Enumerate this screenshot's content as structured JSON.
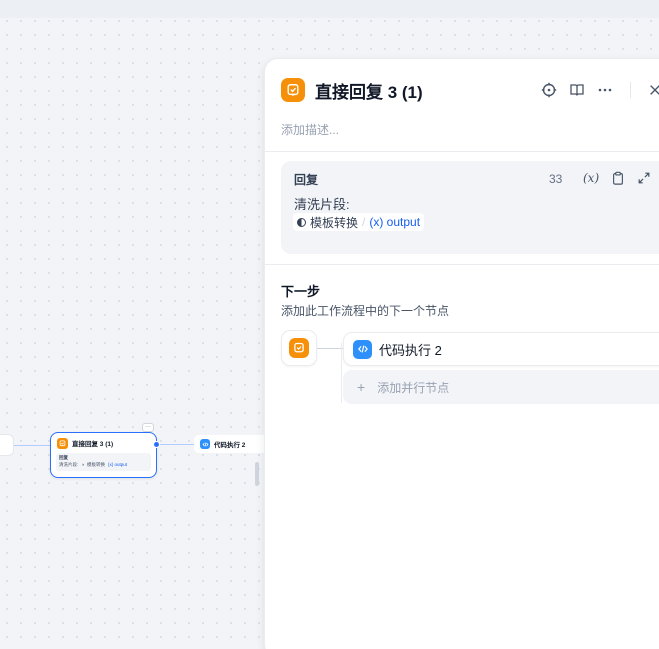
{
  "canvas": {
    "mini_node": {
      "title": "直接回复 3 (1)",
      "section_label": "回复",
      "text": "清洗片段:",
      "var_source": "模板转换",
      "var_name": "{x} output"
    },
    "mini_next_node": {
      "title": "代码执行 2"
    }
  },
  "panel": {
    "title": "直接回复 3 (1)",
    "description_placeholder": "添加描述...",
    "header_icons": [
      "crosshair-icon",
      "book-icon",
      "more-icon",
      "close-icon"
    ],
    "reply": {
      "label": "回复",
      "count": "33",
      "insert_var": "(x)",
      "text": "清洗片段:",
      "var_source": "模板转换",
      "var_slash": "/",
      "var_name": "(x) output"
    },
    "next_step": {
      "title": "下一步",
      "description": "添加此工作流程中的下一个节点",
      "next_node": "代码执行 2",
      "add_parallel": "添加并行节点"
    }
  },
  "colors": {
    "reply_node": "#f79009",
    "code_node": "#2e90fa",
    "accent": "#2970ff"
  }
}
